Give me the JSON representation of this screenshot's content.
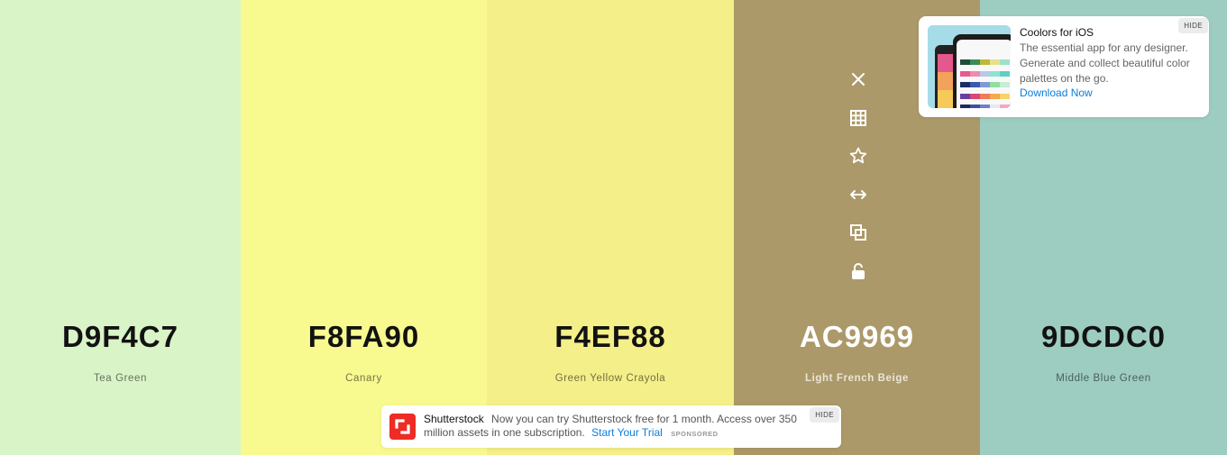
{
  "colors": [
    {
      "hex": "D9F4C7",
      "name": "Tea Green",
      "bg": "#D9F4C7",
      "theme": "dark"
    },
    {
      "hex": "F8FA90",
      "name": "Canary",
      "bg": "#F8FA90",
      "theme": "dark"
    },
    {
      "hex": "F4EF88",
      "name": "Green Yellow Crayola",
      "bg": "#F4EF88",
      "theme": "dark"
    },
    {
      "hex": "AC9969",
      "name": "Light French Beige",
      "bg": "#AC9969",
      "theme": "light"
    },
    {
      "hex": "9DCDC0",
      "name": "Middle Blue Green",
      "bg": "#9DCDC0",
      "theme": "dark"
    }
  ],
  "toolbar_icons": [
    "close-icon",
    "shades-grid-icon",
    "favorite-star-icon",
    "drag-arrows-icon",
    "copy-icon",
    "unlock-icon"
  ],
  "ads": {
    "ios": {
      "title": "Coolors for iOS",
      "description": "The essential app for any designer. Generate and collect beautiful color palettes on the go.",
      "cta": "Download Now",
      "hide": "HIDE"
    },
    "shutterstock": {
      "brand": "Shutterstock",
      "text": "Now you can try Shutterstock free for 1 month. Access over 350 million assets in one subscription.",
      "cta": "Start Your Trial",
      "sponsored": "SPONSORED",
      "hide": "HIDE"
    }
  }
}
